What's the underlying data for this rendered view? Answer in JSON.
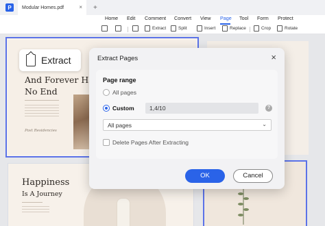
{
  "window": {
    "app_logo": "P",
    "tab_title": "Modular Homes.pdf",
    "tab_close": "×",
    "new_tab": "+"
  },
  "menu": {
    "items": [
      "Home",
      "Edit",
      "Comment",
      "Convert",
      "View",
      "Page",
      "Tool",
      "Form",
      "Protect"
    ],
    "active": "Page"
  },
  "toolbar": {
    "extract": "Extract",
    "split": "Split",
    "insert": "Insert",
    "replace": "Replace",
    "crop": "Crop",
    "rotate": "Rotate"
  },
  "document": {
    "page1_title": "And Forever Has No End",
    "page1_signature": "Post Residencies",
    "page3_title": "Happiness",
    "page3_subtitle": "Is A Journey"
  },
  "extract_chip": {
    "label": "Extract"
  },
  "dialog": {
    "title": "Extract Pages",
    "close": "×",
    "section_label": "Page range",
    "option_all": "All pages",
    "option_custom": "Custom",
    "custom_range_value": "1,4/10",
    "help": "?",
    "subset_select": "All pages",
    "delete_after_label": "Delete Pages After Extracting",
    "ok_label": "OK",
    "cancel_label": "Cancel"
  },
  "colors": {
    "accent": "#2a63e8",
    "selection_border": "#5b72e8"
  }
}
